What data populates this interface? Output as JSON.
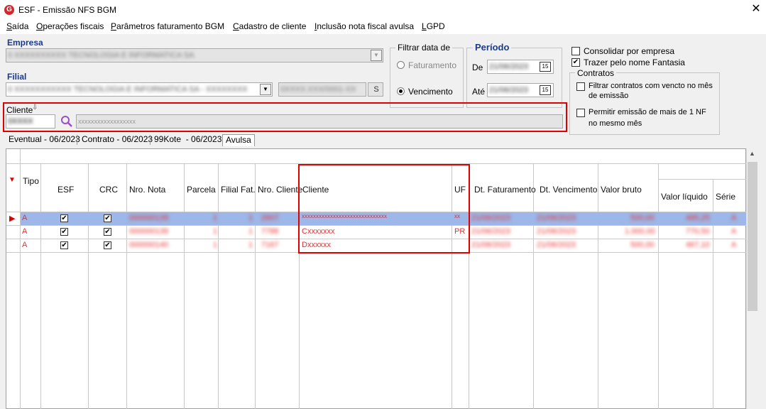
{
  "window": {
    "title": "ESF - Emissão NFS BGM",
    "close_glyph": "✕"
  },
  "menu": [
    "Saída",
    "Operações fiscais",
    "Parâmetros faturamento BGM",
    "Cadastro de cliente",
    "Inclusão nota fiscal avulsa",
    "LGPD"
  ],
  "empresa": {
    "label": "Empresa",
    "value": "0 XXXXXXXXXX TECNOLOGIA E INFORMATICA SA"
  },
  "filial": {
    "label": "Filial",
    "value": "0 XXXXXXXXXXX TECNOLOGIA E INFORMATICA SA - XXXXXXXX",
    "code": "0XXXX.XXX/0001-XX",
    "s_label": "S"
  },
  "filtrar": {
    "title": "Filtrar data de",
    "faturamento": "Faturamento",
    "vencimento": "Vencimento",
    "selected": "vencimento"
  },
  "periodo": {
    "title": "Período",
    "de_label": "De",
    "de_value": "21/06/2023",
    "ate_label": "Até",
    "ate_value": "21/06/2023",
    "cal_glyph": "15"
  },
  "options": {
    "consolidar": "Consolidar por empresa",
    "consolidar_checked": false,
    "trazer": "Trazer pelo nome Fantasia",
    "trazer_checked": true
  },
  "contratos": {
    "title": "Contratos",
    "filtrar_line1": "Filtrar contratos com vencto no mês",
    "filtrar_line2": "de emissão",
    "permitir_line1": "Permitir emissão de mais de 1 NF",
    "permitir_line2": "no mesmo mês"
  },
  "cliente": {
    "label": "Cliente",
    "code": "0XXXX",
    "name_placeholder": "xxxxxxxxxxxxxxxxxx"
  },
  "tabs": [
    "Eventual - 06/2023",
    "Contrato - 06/2023",
    "99Kote  - 06/2023",
    "Avulsa"
  ],
  "grid": {
    "columns": [
      "Tipo",
      "ESF",
      "CRC",
      "Nro. Nota",
      "Parcela",
      "Filial Fat.",
      "Nro. Cliente",
      "Cliente",
      "UF",
      "Dt. Faturamento",
      "Dt. Vencimento",
      "Valor bruto",
      "Valor líquido",
      "Série"
    ],
    "rows": [
      {
        "tipo": "A",
        "esf": true,
        "crc": true,
        "nota": "000000139",
        "parcela": "1",
        "filial": "1",
        "nro_cliente": "2607",
        "cliente": "xxxxxxxxxxxxxxxxxxxxxxxxxxxxxx",
        "uf": "xx",
        "dt_fat": "21/06/2023",
        "dt_venc": "21/06/2023",
        "bruto": "500,00",
        "liquido": "485,25",
        "serie": "A"
      },
      {
        "tipo": "A",
        "esf": true,
        "crc": true,
        "nota": "000000139",
        "parcela": "1",
        "filial": "1",
        "nro_cliente": "7788",
        "cliente": "Cxxxxxxx",
        "uf": "PR",
        "dt_fat": "21/06/2023",
        "dt_venc": "21/06/2023",
        "bruto": "1.000,00",
        "liquido": "770,50",
        "serie": "A"
      },
      {
        "tipo": "A",
        "esf": true,
        "crc": true,
        "nota": "000000140",
        "parcela": "1",
        "filial": "1",
        "nro_cliente": "7167",
        "cliente": "Dxxxxxx",
        "uf": "",
        "dt_fat": "21/06/2023",
        "dt_venc": "21/06/2023",
        "bruto": "500,00",
        "liquido": "467,10",
        "serie": "A"
      }
    ]
  },
  "colors": {
    "accent_red": "#e00000",
    "selected_row": "#9cb7e8",
    "label_blue": "#1c3a8a"
  }
}
